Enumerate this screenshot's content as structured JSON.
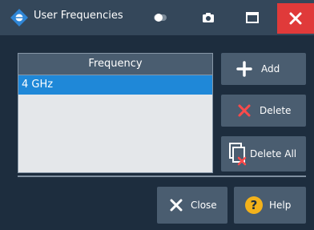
{
  "window": {
    "title": "User Frequencies",
    "icons": [
      "app-logo-icon",
      "toggle-icon",
      "camera-icon",
      "maximize-icon",
      "close-icon"
    ]
  },
  "table": {
    "header": "Frequency",
    "rows": [
      "4 GHz"
    ],
    "selected_row": 0
  },
  "buttons": {
    "add": "Add",
    "delete": "Delete",
    "delete_all": "Delete All",
    "close": "Close",
    "help": "Help"
  },
  "colors": {
    "titlebar": "#34475a",
    "background": "#1d2d3e",
    "button": "#4a5d70",
    "selection": "#1f88d8",
    "close_window": "#e03a3a",
    "delete_x": "#ff4a4a",
    "help_badge": "#f3b21b"
  }
}
